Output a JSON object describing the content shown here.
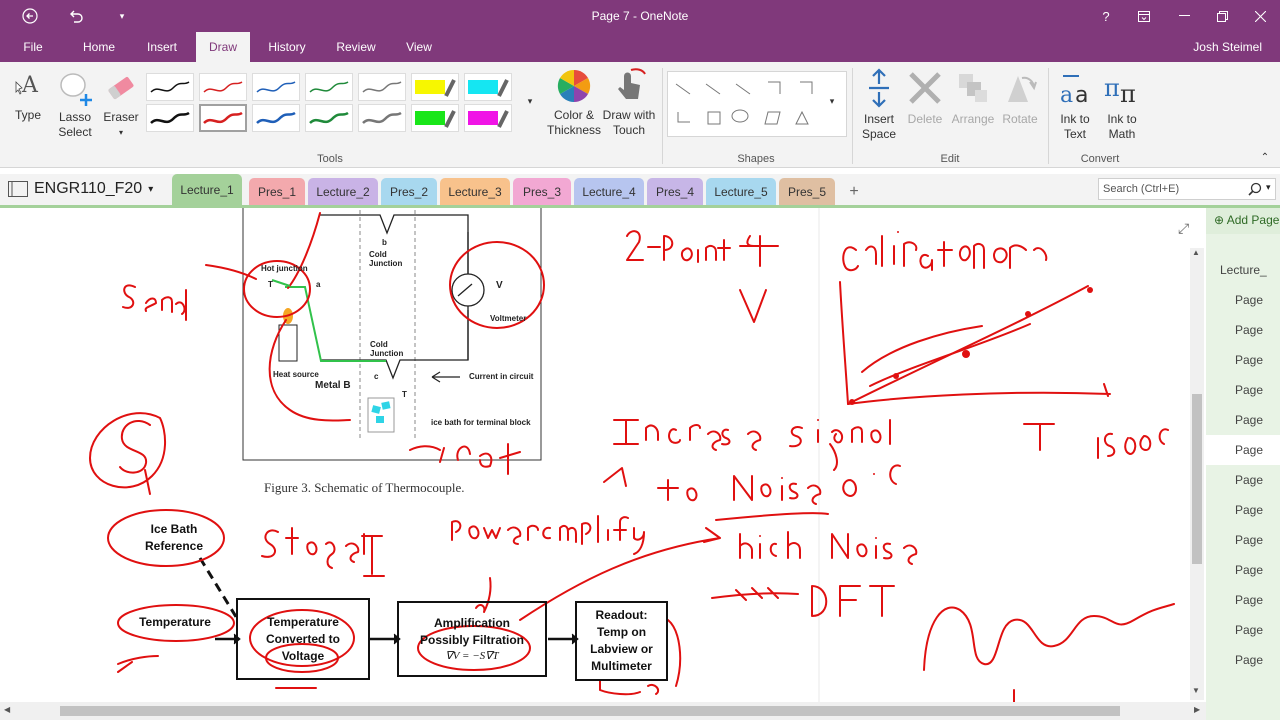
{
  "window": {
    "title": "Page 7 - OneNote",
    "user": "Josh Steimel"
  },
  "ribbon_tabs": [
    "File",
    "Home",
    "Insert",
    "Draw",
    "History",
    "Review",
    "View"
  ],
  "ribbon": {
    "type": "Type",
    "lasso": "Lasso\nSelect",
    "eraser": "Eraser",
    "color_thickness": "Color &\nThickness",
    "draw_touch": "Draw with\nTouch",
    "insert_space": "Insert\nSpace",
    "delete": "Delete",
    "arrange": "Arrange",
    "rotate": "Rotate",
    "ink_text": "Ink to\nText",
    "ink_math": "Ink to\nMath",
    "groups": {
      "tools": "Tools",
      "shapes": "Shapes",
      "edit": "Edit",
      "convert": "Convert"
    }
  },
  "notebook": {
    "name": "ENGR110_F20"
  },
  "sections": [
    {
      "label": "Lecture_1",
      "color": "#a4d19a"
    },
    {
      "label": "Pres_1",
      "color": "#f3a9ad"
    },
    {
      "label": "Lecture_2",
      "color": "#c9b3e6"
    },
    {
      "label": "Pres_2",
      "color": "#a8d8ef"
    },
    {
      "label": "Lecture_3",
      "color": "#f8c28c"
    },
    {
      "label": "Pres_3",
      "color": "#f2a8d3"
    },
    {
      "label": "Lecture_4",
      "color": "#b7c5ef"
    },
    {
      "label": "Pres_4",
      "color": "#c7b6e7"
    },
    {
      "label": "Lecture_5",
      "color": "#a8d8ef"
    },
    {
      "label": "Pres_5",
      "color": "#dfbfa2"
    }
  ],
  "search": {
    "placeholder": "Search (Ctrl+E)"
  },
  "pages": {
    "add_page": "Add Page",
    "items": [
      "Lecture_",
      "Page",
      "Page",
      "Page",
      "Page",
      "Page",
      "Page",
      "Page",
      "Page",
      "Page",
      "Page",
      "Page",
      "Page",
      "Page"
    ]
  },
  "note": {
    "figure_caption": "Figure 3. Schematic of Thermocouple.",
    "diagram": {
      "hot_junction": "Hot junction",
      "cold_junction_b": "Cold\nJunction",
      "cold_junction_c": "Cold\nJunction",
      "voltmeter": "Voltmeter",
      "heat_source": "Heat source",
      "metal_b": "Metal B",
      "current": "Current in circuit",
      "ice_bath": "ice bath for terminal block",
      "a": "a",
      "b": "b",
      "c": "c",
      "th": "T",
      "tc": "T",
      "v": "V"
    },
    "flow": {
      "ice_bath": "Ice Bath\nReference",
      "temperature": "Temperature",
      "converted": "Temperature\nConverted to\nVoltage",
      "amplification": "Amplification\nPossibly Filtration",
      "formula": "∇V = −S∇T",
      "readout": "Readout:\nTemp on\nLabview or\nMultimeter"
    },
    "ink_color": "#e01010"
  }
}
